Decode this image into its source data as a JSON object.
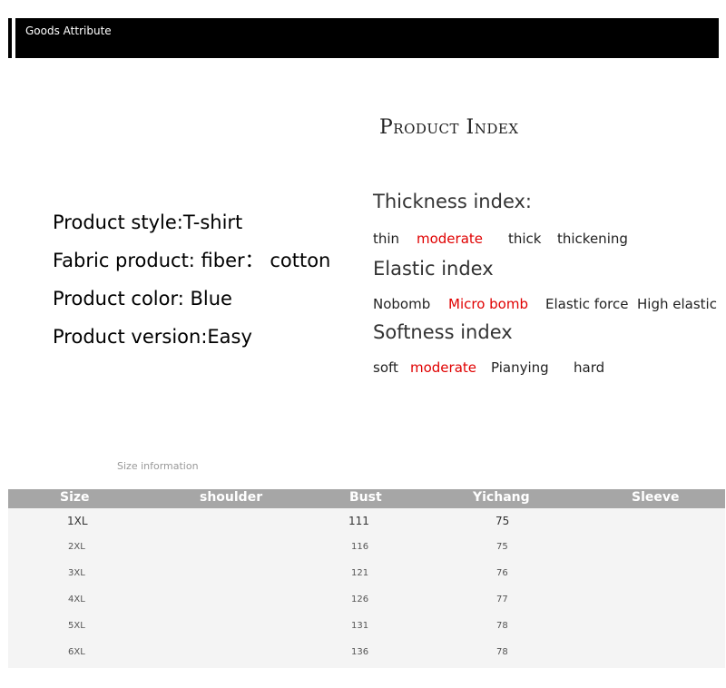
{
  "header": {
    "title": "Goods Attribute"
  },
  "product_index_title": "Product Index",
  "attributes": [
    "Product style:T-shirt",
    "Fabric product: fiber： cotton",
    "Product color:  Blue",
    "Product version:Easy"
  ],
  "indices": {
    "thickness": {
      "heading": "Thickness index:",
      "options": [
        "thin",
        "moderate",
        "thick",
        "thickening"
      ],
      "selected": "moderate"
    },
    "elastic": {
      "heading": "Elastic index",
      "options": [
        "Nobomb",
        "Micro bomb",
        "Elastic force",
        "High elastic"
      ],
      "selected": "Micro bomb"
    },
    "softness": {
      "heading": "Softness index",
      "options": [
        "soft",
        "moderate",
        "Pianying",
        "hard"
      ],
      "selected": "moderate"
    }
  },
  "size_info_caption": "Size information",
  "size_table": {
    "columns": [
      "Size",
      "shoulder",
      "Bust",
      "Yichang",
      "Sleeve"
    ],
    "rows": [
      [
        "1XL",
        "",
        "111",
        "75",
        ""
      ],
      [
        "2XL",
        "",
        "116",
        "75",
        ""
      ],
      [
        "3XL",
        "",
        "121",
        "76",
        ""
      ],
      [
        "4XL",
        "",
        "126",
        "77",
        ""
      ],
      [
        "5XL",
        "",
        "131",
        "78",
        ""
      ],
      [
        "6XL",
        "",
        "136",
        "78",
        ""
      ]
    ]
  },
  "colors": {
    "highlight": "#e00000",
    "table_header": "#a6a6a6"
  }
}
